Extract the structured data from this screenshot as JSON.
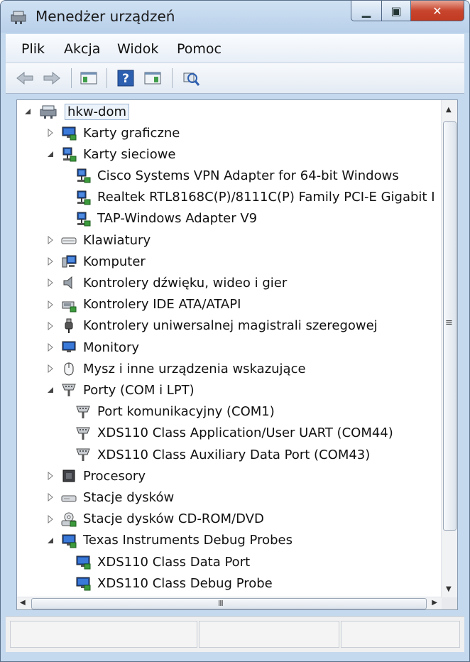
{
  "window": {
    "title": "Menedżer urządzeń"
  },
  "menu": [
    {
      "label": "Plik"
    },
    {
      "label": "Akcja"
    },
    {
      "label": "Widok"
    },
    {
      "label": "Pomoc"
    }
  ],
  "toolbar": [
    "back-icon",
    "forward-icon",
    "properties-pane-icon",
    "help-icon",
    "action-pane-icon",
    "scan-hardware-icon"
  ],
  "tree": {
    "root": "hkw-dom",
    "nodes": [
      {
        "label": "Karty graficzne",
        "icon": "display-adapter-icon"
      },
      {
        "label": "Karty sieciowe",
        "icon": "network-adapter-icon",
        "expanded": true
      },
      {
        "label": "Cisco Systems VPN Adapter for 64-bit Windows",
        "icon": "network-adapter-icon"
      },
      {
        "label": "Realtek RTL8168C(P)/8111C(P) Family PCI-E Gigabit I",
        "icon": "network-adapter-icon"
      },
      {
        "label": "TAP-Windows Adapter V9",
        "icon": "network-adapter-icon"
      },
      {
        "label": "Klawiatury",
        "icon": "keyboard-icon"
      },
      {
        "label": "Komputer",
        "icon": "computer-icon"
      },
      {
        "label": "Kontrolery dźwięku, wideo i gier",
        "icon": "speaker-icon"
      },
      {
        "label": "Kontrolery IDE ATA/ATAPI",
        "icon": "ide-controller-icon"
      },
      {
        "label": "Kontrolery uniwersalnej magistrali szeregowej",
        "icon": "usb-icon"
      },
      {
        "label": "Monitory",
        "icon": "monitor-icon"
      },
      {
        "label": "Mysz i inne urządzenia wskazujące",
        "icon": "mouse-icon"
      },
      {
        "label": "Porty (COM i LPT)",
        "icon": "port-icon",
        "expanded": true
      },
      {
        "label": "Port komunikacyjny (COM1)",
        "icon": "port-icon"
      },
      {
        "label": "XDS110 Class Application/User UART (COM44)",
        "icon": "port-icon"
      },
      {
        "label": "XDS110 Class Auxiliary Data Port (COM43)",
        "icon": "port-icon"
      },
      {
        "label": "Procesory",
        "icon": "processor-icon"
      },
      {
        "label": "Stacje dysków",
        "icon": "disk-drive-icon"
      },
      {
        "label": "Stacje dysków CD-ROM/DVD",
        "icon": "cdrom-icon"
      },
      {
        "label": "Texas Instruments Debug Probes",
        "icon": "debug-probe-icon",
        "expanded": true
      },
      {
        "label": "XDS110 Class Data Port",
        "icon": "debug-probe-icon"
      },
      {
        "label": "XDS110 Class Debug Probe",
        "icon": "debug-probe-icon"
      }
    ]
  },
  "scrollbar": {
    "grip": "≡",
    "hgrip": "III"
  }
}
